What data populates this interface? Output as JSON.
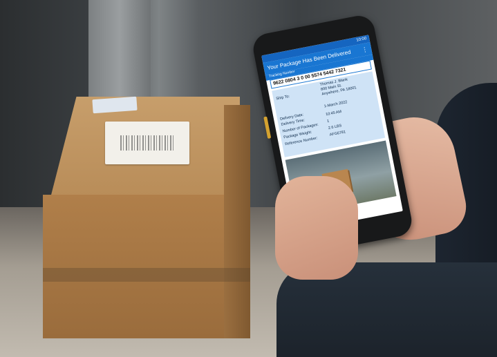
{
  "phone_app": {
    "status_time": "10:00",
    "title": "Your Package Has Been Delivered",
    "tracking_label": "Tracking Number",
    "tracking_number": "9622 0804 3 0 00 5574 5442 7321",
    "ship_to_label": "Ship To:",
    "ship_to_lines": [
      "Thomas J. Blank",
      "800 Main St.",
      "Anywhere, PA 18001"
    ],
    "delivery_date_label": "Delivery Date:",
    "delivery_date": "1-March 2022",
    "delivery_time_label": "Delivery Time:",
    "delivery_time": "10:45 AM",
    "packages_label": "Number of Packages:",
    "packages": "1",
    "weight_label": "Package Weight:",
    "weight": "2.6 LBS",
    "reference_label": "Reference Number:",
    "reference": "AFG6781"
  }
}
